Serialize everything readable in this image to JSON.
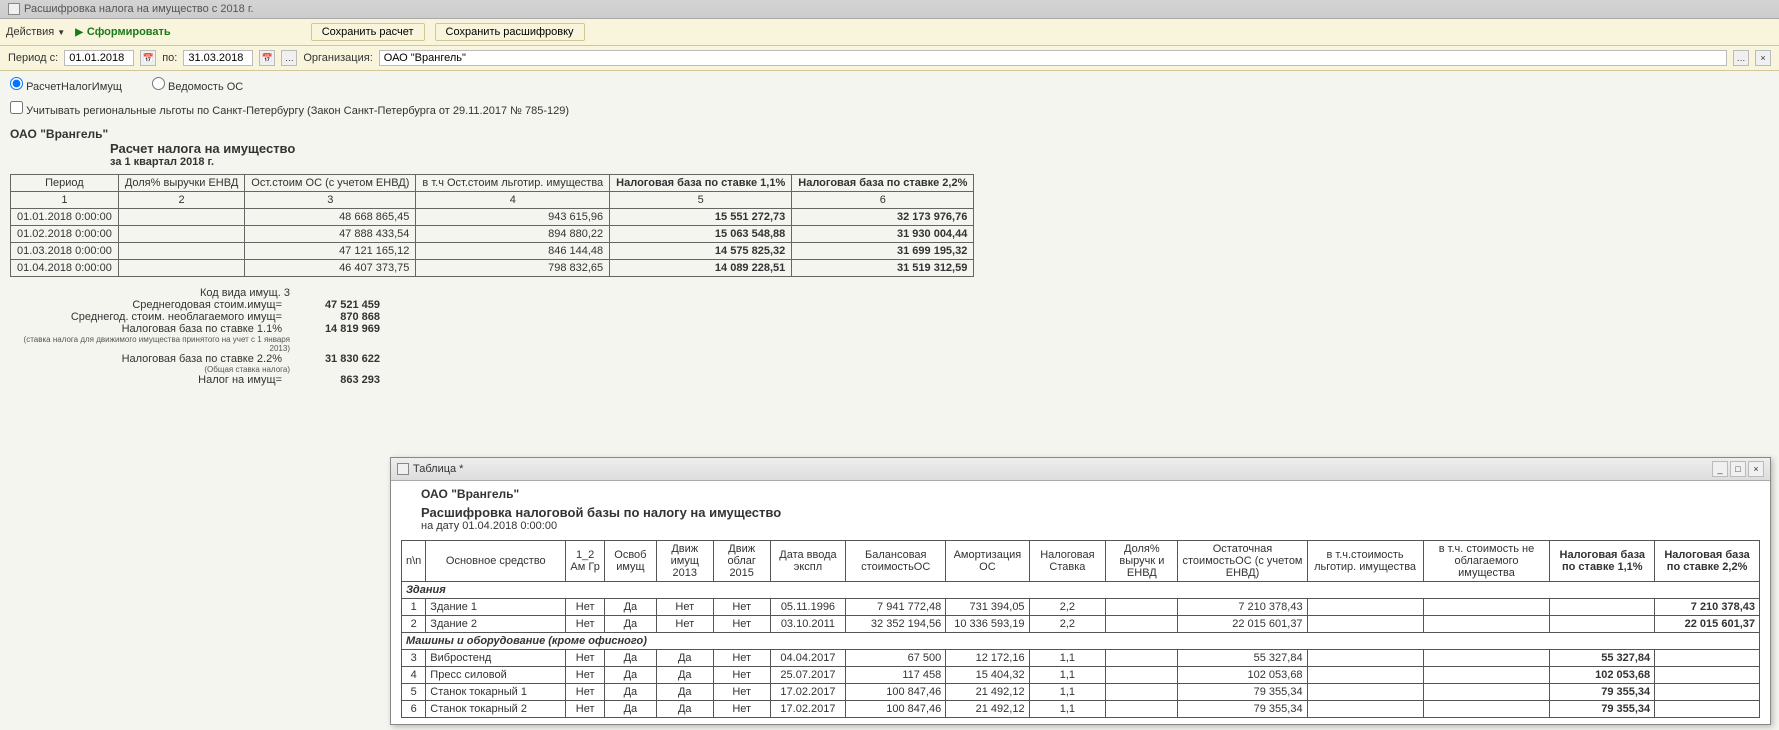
{
  "window": {
    "title": "Расшифровка налога на имущество с 2018 г."
  },
  "toolbar": {
    "actions": "Действия",
    "form": "Сформировать",
    "save_calc": "Сохранить расчет",
    "save_detail": "Сохранить расшифровку"
  },
  "params": {
    "period_label": "Период с:",
    "date_from": "01.01.2018",
    "to_label": "по:",
    "date_to": "31.03.2018",
    "org_label": "Организация:",
    "org_value": "ОАО \"Врангель\""
  },
  "radios": {
    "calc": "РасчетНалогИмущ",
    "vedom": "Ведомость ОС"
  },
  "checkbox": {
    "regional": "Учитывать региональные льготы по Санкт-Петербургу (Закон Санкт-Петербурга от 29.11.2017 № 785-129)"
  },
  "report": {
    "org": "ОАО \"Врангель\"",
    "title": "Расчет налога на имущество",
    "subtitle": "за 1 квартал 2018 г.",
    "headers": {
      "period": "Период",
      "share": "Доля% выручки ЕНВД",
      "ost": "Ост.стоим ОС (с учетом ЕНВД)",
      "lgot": "в т.ч Ост.стоим льготир. имущества",
      "base11": "Налоговая база по ставке 1,1%",
      "base22": "Налоговая база по ставке 2,2%"
    },
    "colnums": [
      "1",
      "2",
      "3",
      "4",
      "5",
      "6"
    ],
    "rows": [
      {
        "period": "01.01.2018 0:00:00",
        "share": "",
        "ost": "48 668 865,45",
        "lgot": "943 615,96",
        "b11": "15 551 272,73",
        "b22": "32 173 976,76"
      },
      {
        "period": "01.02.2018 0:00:00",
        "share": "",
        "ost": "47 888 433,54",
        "lgot": "894 880,22",
        "b11": "15 063 548,88",
        "b22": "31 930 004,44"
      },
      {
        "period": "01.03.2018 0:00:00",
        "share": "",
        "ost": "47 121 165,12",
        "lgot": "846 144,48",
        "b11": "14 575 825,32",
        "b22": "31 699 195,32"
      },
      {
        "period": "01.04.2018 0:00:00",
        "share": "",
        "ost": "46 407 373,75",
        "lgot": "798 832,65",
        "b11": "14 089 228,51",
        "b22": "31 519 312,59"
      }
    ],
    "kod_label": "Код вида имущ. 3",
    "summary": [
      {
        "label": "Среднегодовая стоим.имущ=",
        "val": "47 521 459",
        "sub": ""
      },
      {
        "label": "Среднегод. стоим. необлагаемого имущ=",
        "val": "870 868",
        "sub": ""
      },
      {
        "label": "Налоговая база по ставке 1.1%",
        "val": "14 819 969",
        "sub": "(ставка налога для движимого имущества принятого на учет с 1 января 2013)"
      },
      {
        "label": "Налоговая база по ставке 2.2%",
        "val": "31 830 622",
        "sub": "(Общая ставка налога)"
      },
      {
        "label": "Налог на имущ=",
        "val": "863 293",
        "sub": ""
      }
    ]
  },
  "floatwin": {
    "title": "Таблица *",
    "org": "ОАО \"Врангель\"",
    "title2": "Расшифровка налоговой базы по налогу на имущество",
    "ondate": "на дату  01.04.2018 0:00:00",
    "headers": {
      "nn": "n\\n",
      "os": "Основное средство",
      "amgr": "1_2 Ам Гр",
      "osvob": "Освоб имущ",
      "dv2013": "Движ имущ 2013",
      "dv2015": "Движ облаг 2015",
      "date": "Дата ввода экспл",
      "bal": "Балансовая стоимостьОС",
      "amort": "Амортизация ОС",
      "rate": "Налоговая Ставка",
      "share": "Доля% выручк и ЕНВД",
      "ost": "Остаточная стоимостьОС (с учетом ЕНВД)",
      "lgot": "в т.ч.стоимость льготир. имущества",
      "neobl": "в т.ч. стоимость не облагаемого имущества",
      "b11": "Налоговая база по ставке 1,1%",
      "b22": "Налоговая база по ставке 2,2%"
    },
    "sections": [
      {
        "title": "Здания",
        "rows": [
          {
            "n": "1",
            "os": "Здание 1",
            "amgr": "Нет",
            "osvob": "Да",
            "dv2013": "Нет",
            "dv2015": "Нет",
            "date": "05.11.1996",
            "bal": "7 941 772,48",
            "amort": "731 394,05",
            "rate": "2,2",
            "share": "",
            "ost": "7 210 378,43",
            "lgot": "",
            "neobl": "",
            "b11": "",
            "b22": "7 210 378,43"
          },
          {
            "n": "2",
            "os": "Здание 2",
            "amgr": "Нет",
            "osvob": "Да",
            "dv2013": "Нет",
            "dv2015": "Нет",
            "date": "03.10.2011",
            "bal": "32 352 194,56",
            "amort": "10 336 593,19",
            "rate": "2,2",
            "share": "",
            "ost": "22 015 601,37",
            "lgot": "",
            "neobl": "",
            "b11": "",
            "b22": "22 015 601,37"
          }
        ]
      },
      {
        "title": "Машины и оборудование (кроме офисного)",
        "rows": [
          {
            "n": "3",
            "os": "Вибростенд",
            "amgr": "Нет",
            "osvob": "Да",
            "dv2013": "Да",
            "dv2015": "Нет",
            "date": "04.04.2017",
            "bal": "67 500",
            "amort": "12 172,16",
            "rate": "1,1",
            "share": "",
            "ost": "55 327,84",
            "lgot": "",
            "neobl": "",
            "b11": "55 327,84",
            "b22": ""
          },
          {
            "n": "4",
            "os": "Пресс силовой",
            "amgr": "Нет",
            "osvob": "Да",
            "dv2013": "Да",
            "dv2015": "Нет",
            "date": "25.07.2017",
            "bal": "117 458",
            "amort": "15 404,32",
            "rate": "1,1",
            "share": "",
            "ost": "102 053,68",
            "lgot": "",
            "neobl": "",
            "b11": "102 053,68",
            "b22": ""
          },
          {
            "n": "5",
            "os": "Станок токарный 1",
            "amgr": "Нет",
            "osvob": "Да",
            "dv2013": "Да",
            "dv2015": "Нет",
            "date": "17.02.2017",
            "bal": "100 847,46",
            "amort": "21 492,12",
            "rate": "1,1",
            "share": "",
            "ost": "79 355,34",
            "lgot": "",
            "neobl": "",
            "b11": "79 355,34",
            "b22": ""
          },
          {
            "n": "6",
            "os": "Станок токарный 2",
            "amgr": "Нет",
            "osvob": "Да",
            "dv2013": "Да",
            "dv2015": "Нет",
            "date": "17.02.2017",
            "bal": "100 847,46",
            "amort": "21 492,12",
            "rate": "1,1",
            "share": "",
            "ost": "79 355,34",
            "lgot": "",
            "neobl": "",
            "b11": "79 355,34",
            "b22": ""
          }
        ]
      }
    ]
  }
}
